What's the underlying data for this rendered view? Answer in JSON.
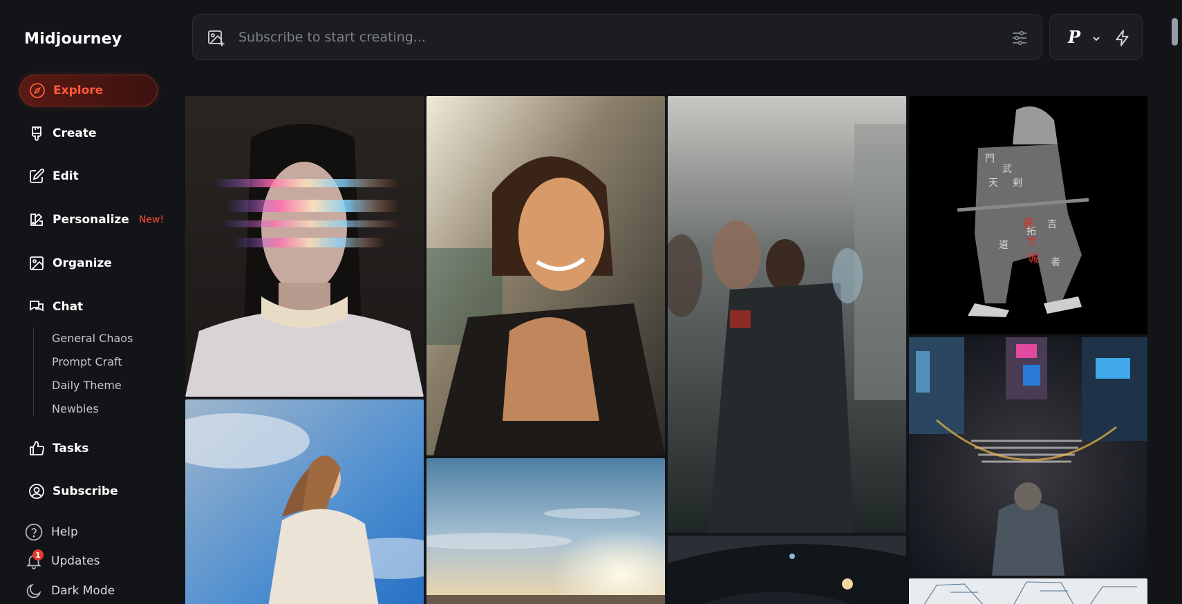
{
  "app": {
    "title": "Midjourney"
  },
  "sidebar": {
    "items": [
      {
        "label": "Explore",
        "icon": "compass-icon"
      },
      {
        "label": "Create",
        "icon": "brush-icon"
      },
      {
        "label": "Edit",
        "icon": "edit-icon"
      },
      {
        "label": "Personalize",
        "icon": "palette-icon",
        "badge": "New!"
      },
      {
        "label": "Organize",
        "icon": "image-icon"
      },
      {
        "label": "Chat",
        "icon": "chat-icon"
      }
    ],
    "chat_channels": [
      "General Chaos",
      "Prompt Craft",
      "Daily Theme",
      "Newbies"
    ],
    "items2": [
      {
        "label": "Tasks",
        "icon": "thumbs-up-icon"
      },
      {
        "label": "Subscribe",
        "icon": "user-circle-icon"
      }
    ],
    "bottom": [
      {
        "label": "Help",
        "icon": "help-icon"
      },
      {
        "label": "Updates",
        "icon": "bell-icon",
        "count": "1"
      },
      {
        "label": "Dark Mode",
        "icon": "moon-icon"
      }
    ]
  },
  "prompt": {
    "placeholder": "Subscribe to start creating..."
  },
  "mode": {
    "label": "P"
  },
  "colors": {
    "accent": "#ff5a3c",
    "background": "#131418",
    "panel": "#1c1d22",
    "badge": "#e53a2f"
  },
  "gallery": [
    {
      "name": "glitch-portrait-image"
    },
    {
      "name": "smiling-woman-backpack-image"
    },
    {
      "name": "blurred-crowd-image"
    },
    {
      "name": "kanji-samurai-image"
    },
    {
      "name": "woman-sweater-sky-image"
    },
    {
      "name": "sunset-sky-image"
    },
    {
      "name": "car-interior-image"
    },
    {
      "name": "city-crossing-aerial-image"
    },
    {
      "name": "sketch-building-image"
    }
  ]
}
